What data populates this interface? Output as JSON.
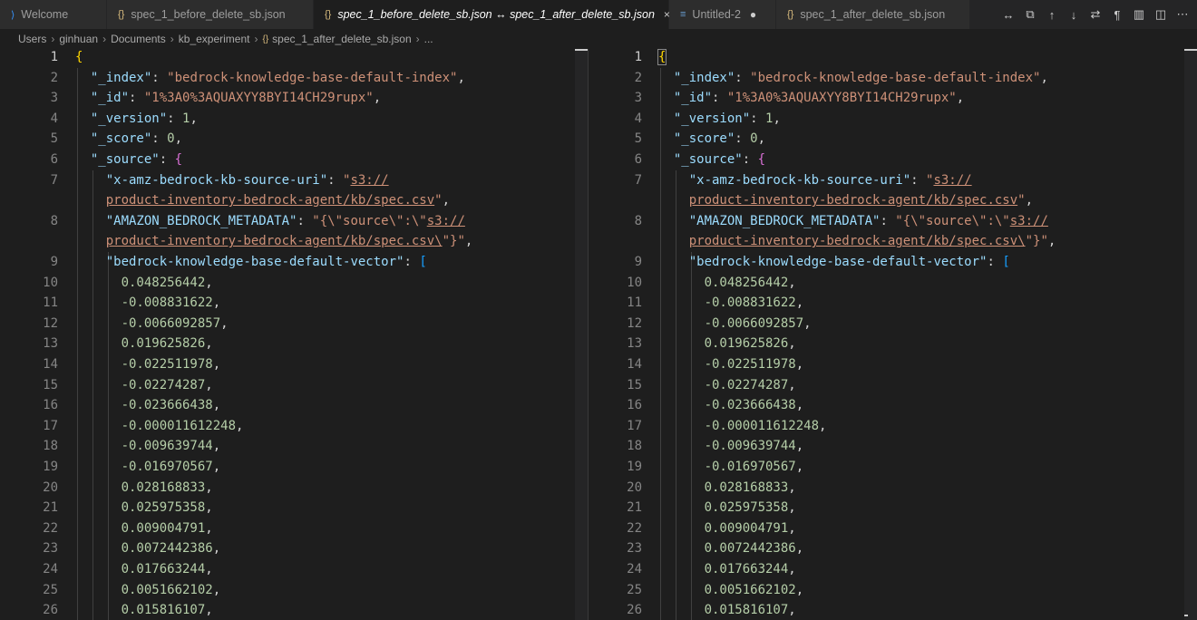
{
  "tabs": [
    {
      "label": "Welcome",
      "icon": "vscode-logo-icon",
      "active": false
    },
    {
      "label": "spec_1_before_delete_sb.json",
      "icon": "json-file-icon",
      "active": false
    },
    {
      "label": "spec_1_before_delete_sb.json ↔ spec_1_after_delete_sb.json",
      "icon": "json-file-icon",
      "active": true,
      "close": "×"
    },
    {
      "label": "Untitled-2",
      "icon": "untitled-file-icon",
      "active": false,
      "dirty": "●"
    },
    {
      "label": "spec_1_after_delete_sb.json",
      "icon": "json-file-icon",
      "active": false
    }
  ],
  "breadcrumb": {
    "items": [
      "Users",
      "ginhuan",
      "Documents",
      "kb_experiment",
      "spec_1_after_delete_sb.json",
      "..."
    ],
    "separator": "›"
  },
  "toolbar_icons": [
    "swap-icon",
    "diff-toggle-icon",
    "previous-change-icon",
    "next-change-icon",
    "swap-sides-icon",
    "whitespace-icon",
    "minimap-icon",
    "split-editor-icon",
    "more-icon"
  ],
  "colors": {
    "background": "#1e1e1e",
    "key": "#9cdcfe",
    "string": "#ce9178",
    "number": "#b5cea8",
    "bracket_1": "#ffd700",
    "bracket_2": "#da70d6",
    "bracket_3": "#179fff"
  },
  "code": {
    "line_numbers": [
      "1",
      "2",
      "3",
      "4",
      "5",
      "6",
      "7",
      "",
      "8",
      "",
      "9",
      "10",
      "11",
      "12",
      "13",
      "14",
      "15",
      "16",
      "17",
      "18",
      "19",
      "20",
      "21",
      "22",
      "23",
      "24",
      "25",
      "26"
    ],
    "open_brace": "{",
    "index_key": "\"_index\"",
    "index_val": "\"bedrock-knowledge-base-default-index\"",
    "id_key": "\"_id\"",
    "id_val": "\"1%3A0%3AQUAXYY8BYI14CH29rupx\"",
    "version_key": "\"_version\"",
    "version_val": "1",
    "score_key": "\"_score\"",
    "score_val": "0",
    "source_key": "\"_source\"",
    "source_open": "{",
    "uri_key": "\"x-amz-bedrock-kb-source-uri\"",
    "uri_val_1_pre": "\"",
    "uri_val_1_link": "s3://",
    "uri_val_2_link": "product-inventory-bedrock-agent/kb/spec.csv",
    "uri_val_2_post": "\"",
    "meta_key": "\"AMAZON_BEDROCK_METADATA\"",
    "meta_val_1_pre": "\"{\\\"source\\\":\\\"",
    "meta_val_1_link": "s3://",
    "meta_val_2_link": "product-inventory-bedrock-agent/kb/spec.csv\\",
    "meta_val_2_post": "\"}\"",
    "vector_key": "\"bedrock-knowledge-base-default-vector\"",
    "vector_open": "[",
    "vector": [
      "0.048256442",
      "-0.008831622",
      "-0.0066092857",
      "0.019625826",
      "-0.022511978",
      "-0.02274287",
      "-0.023666438",
      "-0.000011612248",
      "-0.009639744",
      "-0.016970567",
      "0.028168833",
      "0.025975358",
      "0.009004791",
      "0.0072442386",
      "0.017663244",
      "0.0051662102",
      "0.015816107"
    ]
  }
}
